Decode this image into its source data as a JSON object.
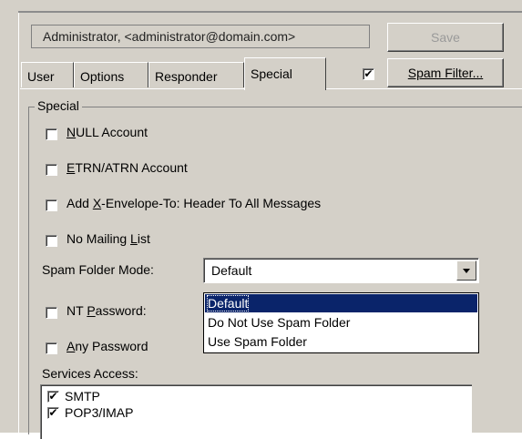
{
  "header": {
    "user_field": "Administrator, <administrator@domain.com>",
    "save_label": "Save"
  },
  "tabs": [
    {
      "label": "User",
      "active": false
    },
    {
      "label": "Options",
      "active": false
    },
    {
      "label": "Responder",
      "active": false
    },
    {
      "label": "Special",
      "active": true
    }
  ],
  "spam_filter": {
    "checked": true,
    "button_label": "Spam Filter..."
  },
  "special_group": {
    "title": "Special",
    "checkboxes": [
      {
        "label_pre": "",
        "underlined": "N",
        "label_post": "ULL Account",
        "checked": false
      },
      {
        "label_pre": "",
        "underlined": "E",
        "label_post": "TRN/ATRN Account",
        "checked": false
      },
      {
        "label_pre": "Add ",
        "underlined": "X",
        "label_post": "-Envelope-To: Header To All Messages",
        "checked": false
      },
      {
        "label_pre": "No Mailing ",
        "underlined": "L",
        "label_post": "ist",
        "checked": false
      }
    ],
    "spam_folder_mode": {
      "label": "Spam Folder Mode:",
      "value": "Default",
      "options": [
        "Default",
        "Do Not Use Spam Folder",
        "Use Spam Folder"
      ]
    },
    "nt_password": {
      "label_pre": "NT ",
      "underlined": "P",
      "label_post": "assword:",
      "checked": false
    },
    "any_password": {
      "label_pre": "",
      "underlined": "A",
      "label_post": "ny Password",
      "checked": false
    },
    "services": {
      "label": "Services Access:",
      "items": [
        {
          "label": "SMTP",
          "checked": true
        },
        {
          "label": "POP3/IMAP",
          "checked": true
        }
      ]
    }
  },
  "colors": {
    "face": "#d4d0c8",
    "highlight": "#0a246a",
    "disabled_text": "#9a9a9a"
  }
}
